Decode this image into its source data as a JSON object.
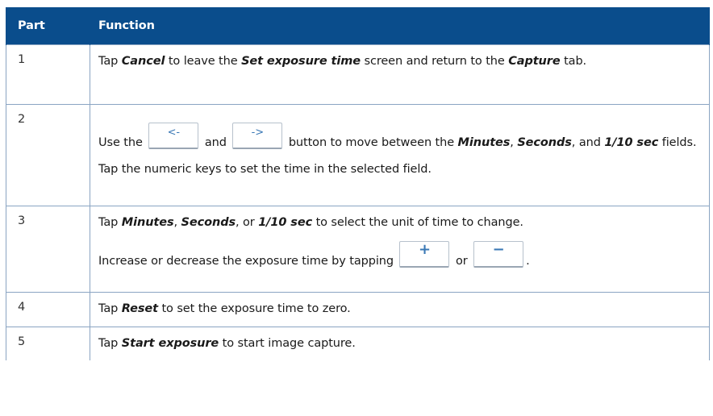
{
  "table": {
    "headers": {
      "part": "Part",
      "function": "Function"
    },
    "rows": [
      {
        "part": "1",
        "lines": [
          [
            "Tap ",
            {
              "t": "Cancel"
            },
            " to leave the ",
            {
              "t": "Set exposure time"
            },
            " screen and return to the ",
            {
              "t": "Capture"
            },
            " tab."
          ]
        ]
      },
      {
        "part": "2",
        "lines": [
          [
            "Use the ",
            {
              "btn": "<-"
            },
            " and ",
            {
              "btn": "->"
            },
            " button to move between the ",
            {
              "t": "Minutes"
            },
            ", ",
            {
              "t": "Seconds"
            },
            ", and ",
            {
              "t": "1/10 sec"
            },
            " fields."
          ],
          [
            "Tap the numeric keys to set the time in the selected field."
          ]
        ]
      },
      {
        "part": "3",
        "lines": [
          [
            "Tap ",
            {
              "t": "Minutes"
            },
            ", ",
            {
              "t": "Seconds"
            },
            ", or ",
            {
              "t": "1/10 sec"
            },
            " to select the unit of time to change."
          ],
          [
            "Increase or decrease the exposure time by tapping ",
            {
              "btn": "+"
            },
            " or ",
            {
              "btn": "−"
            },
            "."
          ]
        ]
      },
      {
        "part": "4",
        "lines": [
          [
            "Tap ",
            {
              "t": "Reset"
            },
            " to set the exposure time to zero."
          ]
        ]
      },
      {
        "part": "5",
        "lines": [
          [
            "Tap ",
            {
              "t": "Start exposure"
            },
            " to start image capture."
          ]
        ]
      }
    ]
  },
  "icons": {
    "<-": "left-arrow-button-icon",
    "->": "right-arrow-button-icon",
    "+": "plus-button-icon",
    "−": "minus-button-icon"
  },
  "colors": {
    "header_bg": "#0a4d8c",
    "header_text": "#ffffff",
    "border": "#8aa4c2",
    "button_glyph": "#3a78b5"
  }
}
